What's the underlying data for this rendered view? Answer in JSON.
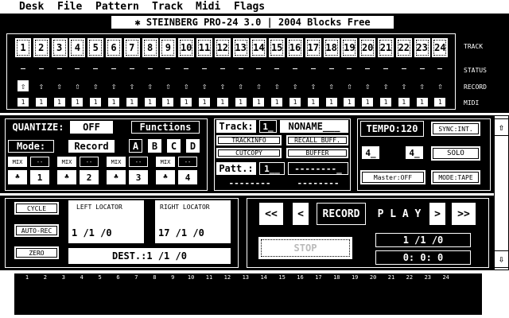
{
  "menu": [
    "Desk",
    "File",
    "Pattern",
    "Track",
    "Midi",
    "Flags"
  ],
  "title": "✱  STEINBERG PRO-24 3.0  | 2004 Blocks Free",
  "tracks": {
    "numbers": [
      "1",
      "2",
      "3",
      "4",
      "5",
      "6",
      "7",
      "8",
      "9",
      "10",
      "11",
      "12",
      "13",
      "14",
      "15",
      "16",
      "17",
      "18",
      "19",
      "20",
      "21",
      "22",
      "23",
      "24"
    ],
    "midi": [
      "1",
      "1",
      "1",
      "1",
      "1",
      "1",
      "1",
      "1",
      "1",
      "1",
      "1",
      "1",
      "1",
      "1",
      "1",
      "1",
      "1",
      "1",
      "1",
      "1",
      "1",
      "1",
      "1",
      "1"
    ],
    "record_glyph": "⇧",
    "status_glyph": "–",
    "label_track": "TRACK",
    "label_status": "STATUS",
    "label_record": "RECORD",
    "label_midi": "MIDI"
  },
  "quantize": {
    "label": "QUANTIZE:",
    "value": "OFF",
    "functions": "Functions",
    "mode_label": "Mode:",
    "mode_value": "Record",
    "abcd": [
      "A",
      "B",
      "C",
      "D"
    ],
    "mix": [
      "MIX",
      "MIX",
      "MIX",
      "MIX"
    ],
    "dash": [
      "--",
      "--",
      "--",
      "--"
    ],
    "nums": [
      "1",
      "2",
      "3",
      "4"
    ]
  },
  "trackinfo": {
    "track_label": "Track:",
    "track_num": "1_",
    "track_name": "NONAME___",
    "btn_trackinfo": "TRACKINFO",
    "btn_recall": "RECALL BUFF.",
    "btn_cutcopy": "CUTCOPY",
    "btn_buffer": "BUFFER",
    "patt_label": "Patt.:",
    "patt_num": "1__",
    "patt_name": "--------_",
    "patt_sub1": "--------",
    "patt_sub2": "--------"
  },
  "tempo": {
    "label": "TEMPO:120",
    "sync": "SYNC:INT.",
    "sig1": "4_",
    "sig2": "4_",
    "solo": "SOLO",
    "master": "Master:OFF",
    "mode": "MODE:TAPE"
  },
  "locators": {
    "cycle": "CYCLE",
    "autorec": "AUTO-REC",
    "zero": "ZERO",
    "left_label": "LEFT LOCATOR",
    "left_value": "1 /1 /0",
    "right_label": "RIGHT LOCATOR",
    "right_value": "17 /1 /0",
    "dest": "DEST.:1  /1 /0"
  },
  "transport": {
    "rew_fast": "<<",
    "rew": "<",
    "record": "RECORD",
    "play": "P L A Y",
    "fwd": ">",
    "fwd_fast": ">>",
    "stop": "STOP",
    "position": "1 /1 /0",
    "time": "0: 0: 0"
  },
  "scroll": {
    "up": "⇧",
    "down": "⇩"
  },
  "grid_numbers": [
    "1",
    "2",
    "3",
    "4",
    "5",
    "6",
    "7",
    "8",
    "9",
    "10",
    "11",
    "12",
    "13",
    "14",
    "15",
    "16",
    "17",
    "18",
    "19",
    "20",
    "21",
    "22",
    "23",
    "24"
  ]
}
